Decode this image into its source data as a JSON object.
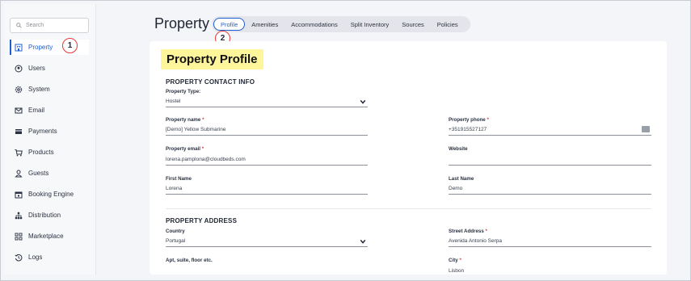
{
  "sidebar": {
    "search_placeholder": "Search",
    "items": [
      {
        "label": "Property",
        "icon": "building-icon"
      },
      {
        "label": "Users",
        "icon": "user-circle-icon"
      },
      {
        "label": "System",
        "icon": "gear-icon"
      },
      {
        "label": "Email",
        "icon": "envelope-icon"
      },
      {
        "label": "Payments",
        "icon": "credit-card-icon"
      },
      {
        "label": "Products",
        "icon": "cart-icon"
      },
      {
        "label": "Guests",
        "icon": "person-icon"
      },
      {
        "label": "Booking Engine",
        "icon": "calendar-icon"
      },
      {
        "label": "Distribution",
        "icon": "sitemap-icon"
      },
      {
        "label": "Marketplace",
        "icon": "grid-icon"
      },
      {
        "label": "Logs",
        "icon": "history-icon"
      }
    ]
  },
  "markers": {
    "one": "1",
    "two": "2"
  },
  "header": {
    "title": "Property"
  },
  "tabs": [
    "Profile",
    "Amenities",
    "Accommodations",
    "Split Inventory",
    "Sources",
    "Policies"
  ],
  "card": {
    "title": "Property Profile",
    "contact_section": "PROPERTY CONTACT INFO",
    "property_type_label": "Property Type:",
    "property_type_value": "Hostel",
    "property_name_label": "Property name",
    "property_name_value": "[Demo] Yellow Submarine",
    "property_phone_label": "Property phone",
    "property_phone_value": "+351915527127",
    "property_email_label": "Property email",
    "property_email_value": "lorena.pamplona@cloudbeds.com",
    "website_label": "Website",
    "website_value": "",
    "first_name_label": "First Name",
    "first_name_value": "Lorena",
    "last_name_label": "Last Name",
    "last_name_value": "Demo",
    "address_section": "PROPERTY ADDRESS",
    "country_label": "Country",
    "country_value": "Portugal",
    "street_label": "Street Address",
    "street_value": "Avenida Antonio Serpa",
    "apt_label": "Apt, suite, floor etc.",
    "city_label": "City",
    "city_value": "Lisbon",
    "required_mark": "*"
  },
  "colors": {
    "accent": "#1d5fd1",
    "highlight": "#fff59a",
    "marker": "#e53935"
  }
}
